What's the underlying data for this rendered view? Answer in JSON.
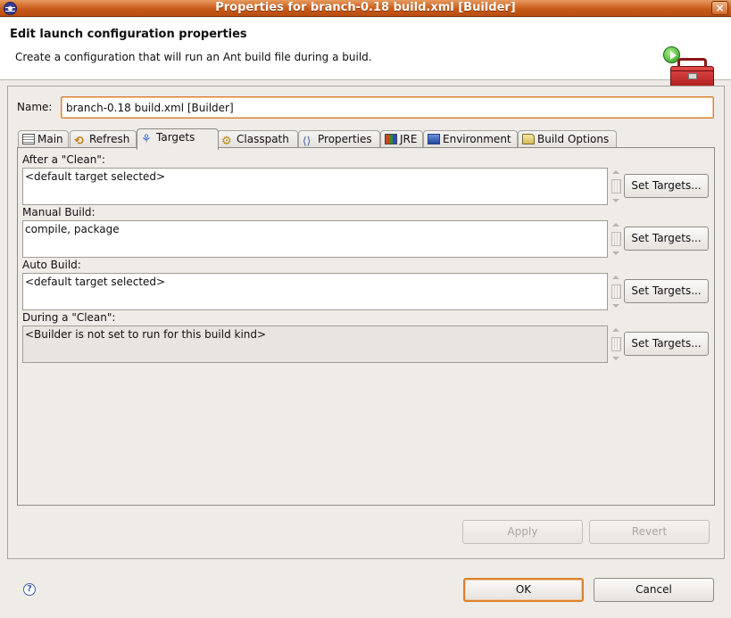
{
  "window": {
    "title": "Properties for branch-0.18 build.xml [Builder]",
    "close_glyph": "×"
  },
  "header": {
    "title": "Edit launch configuration properties",
    "description": "Create a configuration that will run an Ant build file during a build.",
    "icon": "toolbox-run-icon"
  },
  "name_field": {
    "label": "Name:",
    "value": "branch-0.18 build.xml [Builder]"
  },
  "tabs": [
    {
      "label": "Main",
      "icon": "main-icon",
      "active": false
    },
    {
      "label": "Refresh",
      "icon": "refresh-icon",
      "active": false
    },
    {
      "label": "Targets",
      "icon": "targets-icon",
      "active": true
    },
    {
      "label": "Classpath",
      "icon": "classpath-icon",
      "active": false
    },
    {
      "label": "Properties",
      "icon": "properties-icon",
      "active": false
    },
    {
      "label": "JRE",
      "icon": "jre-icon",
      "active": false
    },
    {
      "label": "Environment",
      "icon": "environment-icon",
      "active": false
    },
    {
      "label": "Build Options",
      "icon": "build-options-icon",
      "active": false
    }
  ],
  "sections": [
    {
      "label": "After a \"Clean\":",
      "value": "<default target selected>",
      "button": "Set Targets...",
      "enabled": true
    },
    {
      "label": "Manual Build:",
      "value": "compile, package",
      "button": "Set Targets...",
      "enabled": true
    },
    {
      "label": "Auto Build:",
      "value": "<default target selected>",
      "button": "Set Targets...",
      "enabled": true
    },
    {
      "label": "During a \"Clean\":",
      "value": "<Builder is not set to run for this build kind>",
      "button": "Set Targets...",
      "enabled": false
    }
  ],
  "actions": {
    "apply": "Apply",
    "revert": "Revert",
    "ok": "OK",
    "cancel": "Cancel"
  },
  "help_glyph": "?",
  "colors": {
    "titlebar": "#c85a18",
    "focus": "#d9832f",
    "background": "#efebe7"
  }
}
